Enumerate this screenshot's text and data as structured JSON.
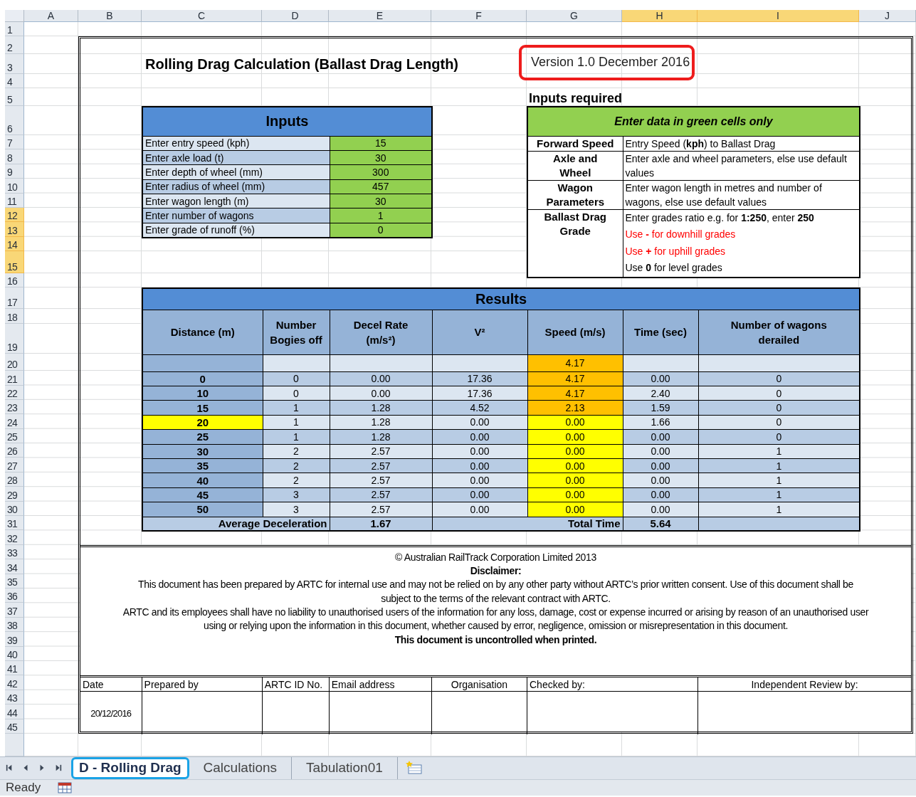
{
  "column_headers": [
    {
      "label": "A",
      "selected": false
    },
    {
      "label": "B",
      "selected": false
    },
    {
      "label": "C",
      "selected": false
    },
    {
      "label": "D",
      "selected": false
    },
    {
      "label": "E",
      "selected": false
    },
    {
      "label": "F",
      "selected": false
    },
    {
      "label": "G",
      "selected": false
    },
    {
      "label": "H",
      "selected": true
    },
    {
      "label": "I",
      "selected": true
    },
    {
      "label": "J",
      "selected": false
    }
  ],
  "row_headers": [
    {
      "label": "1",
      "selected": false
    },
    {
      "label": "2",
      "selected": false
    },
    {
      "label": "3",
      "selected": false
    },
    {
      "label": "4",
      "selected": false
    },
    {
      "label": "5",
      "selected": false
    },
    {
      "label": "6",
      "selected": false
    },
    {
      "label": "7",
      "selected": false
    },
    {
      "label": "8",
      "selected": false
    },
    {
      "label": "9",
      "selected": false
    },
    {
      "label": "10",
      "selected": false
    },
    {
      "label": "11",
      "selected": false
    },
    {
      "label": "12",
      "selected": true
    },
    {
      "label": "13",
      "selected": true
    },
    {
      "label": "14",
      "selected": true
    },
    {
      "label": "15",
      "selected": true
    },
    {
      "label": "16",
      "selected": false
    },
    {
      "label": "17",
      "selected": false
    },
    {
      "label": "18",
      "selected": false
    },
    {
      "label": "19",
      "selected": false
    },
    {
      "label": "20",
      "selected": false
    },
    {
      "label": "21",
      "selected": false
    },
    {
      "label": "22",
      "selected": false
    },
    {
      "label": "23",
      "selected": false
    },
    {
      "label": "24",
      "selected": false
    },
    {
      "label": "25",
      "selected": false
    },
    {
      "label": "26",
      "selected": false
    },
    {
      "label": "27",
      "selected": false
    },
    {
      "label": "28",
      "selected": false
    },
    {
      "label": "29",
      "selected": false
    },
    {
      "label": "30",
      "selected": false
    },
    {
      "label": "31",
      "selected": false
    },
    {
      "label": "32",
      "selected": false
    },
    {
      "label": "33",
      "selected": false
    },
    {
      "label": "34",
      "selected": false
    },
    {
      "label": "35",
      "selected": false
    },
    {
      "label": "36",
      "selected": false
    },
    {
      "label": "37",
      "selected": false
    },
    {
      "label": "38",
      "selected": false
    },
    {
      "label": "39",
      "selected": false
    },
    {
      "label": "40",
      "selected": false
    },
    {
      "label": "41",
      "selected": false
    },
    {
      "label": "42",
      "selected": false
    },
    {
      "label": "43",
      "selected": false
    },
    {
      "label": "44",
      "selected": false
    },
    {
      "label": "45",
      "selected": false
    }
  ],
  "title": "Rolling Drag Calculation (Ballast Drag Length)",
  "version": {
    "text": "Version 1.0 December 2016",
    "highlighted": true
  },
  "inputs": {
    "title": "Inputs",
    "rows": [
      {
        "label": "Enter entry speed (kph)",
        "value": "15"
      },
      {
        "label": "Enter axle load (t)",
        "value": "30"
      },
      {
        "label": "Enter depth of wheel (mm)",
        "value": "300"
      },
      {
        "label": "Enter radius of wheel (mm)",
        "value": "457"
      },
      {
        "label": "Enter wagon length (m)",
        "value": "30"
      },
      {
        "label": "Enter number of wagons",
        "value": "1"
      },
      {
        "label": "Enter grade of runoff (%)",
        "value": "0"
      }
    ]
  },
  "inputs_required": {
    "heading": "Inputs required",
    "banner": "Enter data in green cells only",
    "rows": [
      {
        "label": [
          "Forward Speed"
        ],
        "notes": [
          {
            "text": "Entry Speed (**kph**) to Ballast Drag",
            "warning": false
          }
        ]
      },
      {
        "label": [
          "Axle and",
          "Wheel"
        ],
        "notes": [
          {
            "text": "Enter axle and wheel parameters, else use default values",
            "warning": false
          }
        ]
      },
      {
        "label": [
          "Wagon",
          "Parameters"
        ],
        "notes": [
          {
            "text": "Enter wagon length in metres and number of wagons, else use default values",
            "warning": false
          }
        ]
      },
      {
        "label": [
          "Ballast Drag",
          "Grade"
        ],
        "notes": [
          {
            "text": "Enter grades ratio e.g. for **1:250**, enter **250**",
            "warning": false
          },
          {
            "text": "Use **-** for downhill grades",
            "warning": true
          },
          {
            "text": "Use **+** for uphill grades",
            "warning": true
          },
          {
            "text": "Use **0** for level grades",
            "warning": false
          }
        ]
      }
    ]
  },
  "results": {
    "title": "Results",
    "columns": [
      [
        "Distance (m)"
      ],
      [
        "Number",
        "Bogies off"
      ],
      [
        "Decel Rate",
        "(m/s²)"
      ],
      [
        "V²"
      ],
      [
        "Speed (m/s)"
      ],
      [
        "Time (sec)"
      ],
      [
        "Number of wagons",
        "derailed"
      ]
    ],
    "rows": [
      {
        "speed": "4.17",
        "color": "#ffc000",
        "highlighted": false
      },
      {
        "distance": "0",
        "bogies": "0",
        "decel": "0.00",
        "v2": "17.36",
        "speed": "4.17",
        "time": "0.00",
        "derailed": "0",
        "color": "#ffc000",
        "highlighted": false
      },
      {
        "distance": "10",
        "bogies": "0",
        "decel": "0.00",
        "v2": "17.36",
        "speed": "4.17",
        "time": "2.40",
        "derailed": "0",
        "color": "#ffc000",
        "highlighted": false
      },
      {
        "distance": "15",
        "bogies": "1",
        "decel": "1.28",
        "v2": "4.52",
        "speed": "2.13",
        "time": "1.59",
        "derailed": "0",
        "color": "#ffc000",
        "highlighted": false
      },
      {
        "distance": "20",
        "bogies": "1",
        "decel": "1.28",
        "v2": "0.00",
        "speed": "0.00",
        "time": "1.66",
        "derailed": "0",
        "color": "#ffff00",
        "highlighted": true
      },
      {
        "distance": "25",
        "bogies": "1",
        "decel": "1.28",
        "v2": "0.00",
        "speed": "0.00",
        "time": "0.00",
        "derailed": "0",
        "color": "#ffff00",
        "highlighted": false
      },
      {
        "distance": "30",
        "bogies": "2",
        "decel": "2.57",
        "v2": "0.00",
        "speed": "0.00",
        "time": "0.00",
        "derailed": "1",
        "color": "#ffff00",
        "highlighted": false
      },
      {
        "distance": "35",
        "bogies": "2",
        "decel": "2.57",
        "v2": "0.00",
        "speed": "0.00",
        "time": "0.00",
        "derailed": "1",
        "color": "#ffff00",
        "highlighted": false
      },
      {
        "distance": "40",
        "bogies": "2",
        "decel": "2.57",
        "v2": "0.00",
        "speed": "0.00",
        "time": "0.00",
        "derailed": "1",
        "color": "#ffff00",
        "highlighted": false
      },
      {
        "distance": "45",
        "bogies": "3",
        "decel": "2.57",
        "v2": "0.00",
        "speed": "0.00",
        "time": "0.00",
        "derailed": "1",
        "color": "#ffff00",
        "highlighted": false
      },
      {
        "distance": "50",
        "bogies": "3",
        "decel": "2.57",
        "v2": "0.00",
        "speed": "0.00",
        "time": "0.00",
        "derailed": "1",
        "color": "#ffff00",
        "highlighted": false
      }
    ],
    "summary": [
      {
        "label": "Average Deceleration",
        "value": "1.67"
      },
      {
        "label": "Total Time",
        "value": "5.64"
      }
    ]
  },
  "disclaimer": {
    "copyright": "© Australian RailTrack Corporation Limited 2013",
    "heading": "Disclaimer:",
    "paragraphs": [
      [
        "This document has been prepared by ARTC for internal use and may not be relied on by any other party without ARTC’s prior written consent.  Use of this document shall be",
        "subject to the terms of the relevant contract with ARTC."
      ],
      [
        "ARTC and its employees shall have no liability to unauthorised users of the information for any loss, damage, cost or expense incurred or arising by reason of an unauthorised user",
        "using or relying upon the information in this document, whether caused by error, negligence, omission or misrepresentation in this document."
      ]
    ],
    "notice": "This document is uncontrolled  when printed."
  },
  "signoff": [
    {
      "heading": "Date",
      "value": "20/12/2016"
    },
    {
      "heading": "Prepared by"
    },
    {
      "heading": "ARTC ID No."
    },
    {
      "heading": "Email address"
    },
    {
      "heading": "Organisation"
    },
    {
      "heading": "Checked by:"
    },
    {
      "heading": "Independent Review by:"
    }
  ],
  "sheet_tabs": [
    {
      "label": "D - Rolling Drag",
      "selected": true,
      "highlighted": true
    },
    {
      "label": "Calculations",
      "selected": false,
      "highlighted": false
    },
    {
      "label": "Tabulation01",
      "selected": false,
      "highlighted": false
    }
  ],
  "status_bar": {
    "text": "Ready"
  }
}
